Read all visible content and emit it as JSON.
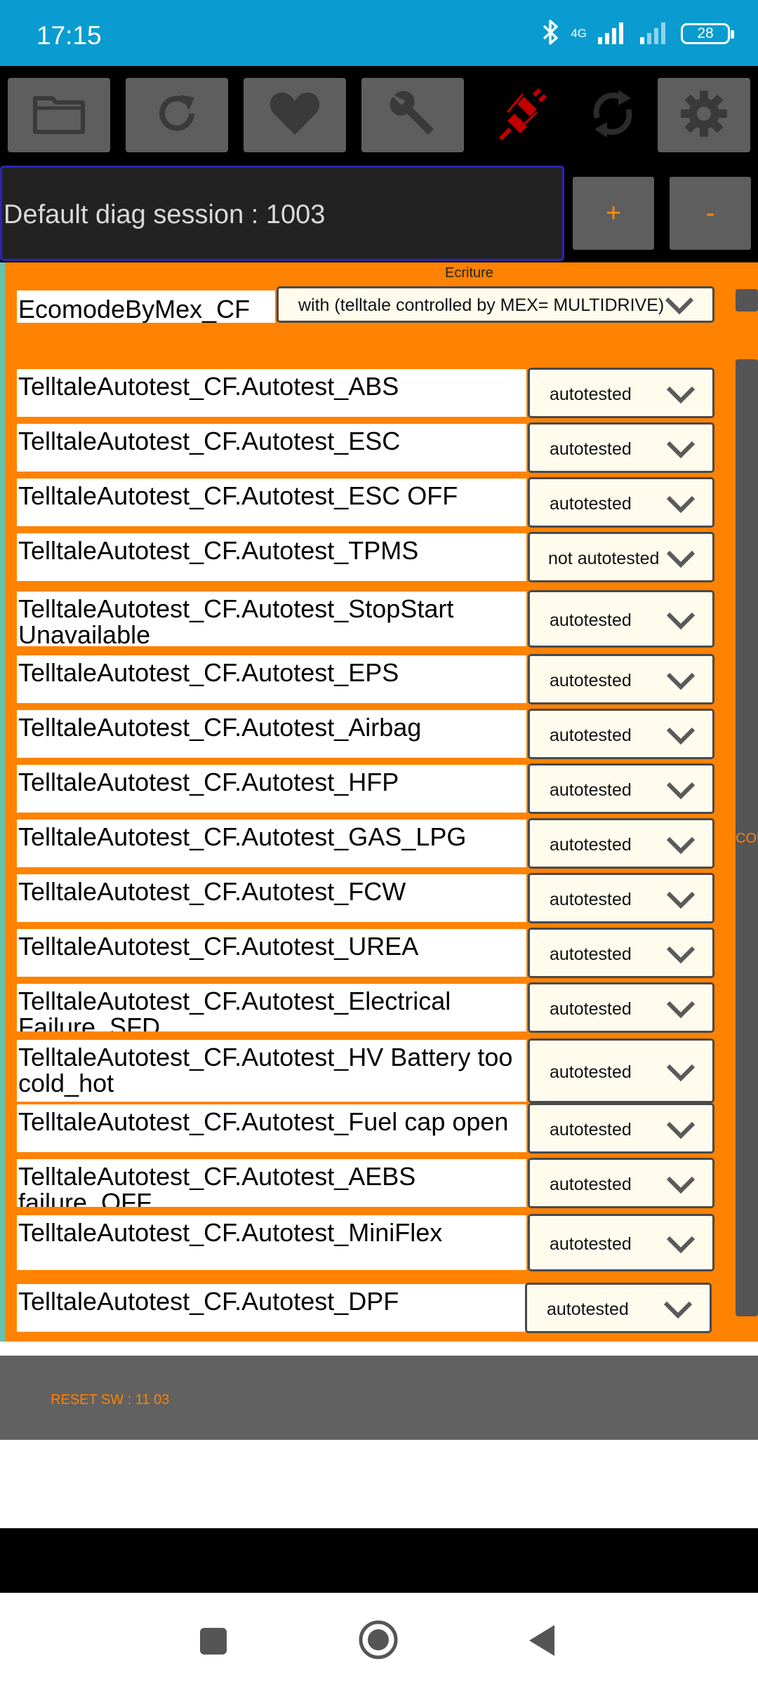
{
  "status_bar": {
    "time": "17:15",
    "network": "4G",
    "battery": "28",
    "icons": [
      "bluetooth-icon",
      "signal-icon",
      "signal-icon",
      "battery-icon"
    ]
  },
  "toolbar": {
    "icons": [
      "folder-icon",
      "refresh-icon",
      "heart-icon",
      "wrench-icon",
      "disconnected-plug-icon",
      "sync-icon",
      "gear-icon"
    ],
    "accent": "#ff8200",
    "plug_color": "#c00000"
  },
  "session": {
    "text": "Default diag session : 1003",
    "plus_label": "+",
    "minus_label": "-"
  },
  "panel": {
    "section_label": "Ecriture",
    "side_text": "CON",
    "ecomode": {
      "label": "EcomodeByMex_CF",
      "value": "with (telltale controlled by MEX= MULTIDRIVE)"
    },
    "rows": [
      {
        "label": "TelltaleAutotest_CF.Autotest_ABS",
        "value": "autotested"
      },
      {
        "label": "TelltaleAutotest_CF.Autotest_ESC",
        "value": "autotested"
      },
      {
        "label": "TelltaleAutotest_CF.Autotest_ESC OFF",
        "value": "autotested"
      },
      {
        "label": "TelltaleAutotest_CF.Autotest_TPMS",
        "value": "not autotested"
      },
      {
        "label": "TelltaleAutotest_CF.Autotest_StopStart Unavailable",
        "value": "autotested"
      },
      {
        "label": "TelltaleAutotest_CF.Autotest_EPS",
        "value": "autotested"
      },
      {
        "label": "TelltaleAutotest_CF.Autotest_Airbag",
        "value": "autotested"
      },
      {
        "label": "TelltaleAutotest_CF.Autotest_HFP",
        "value": "autotested"
      },
      {
        "label": "TelltaleAutotest_CF.Autotest_GAS_LPG",
        "value": "autotested"
      },
      {
        "label": "TelltaleAutotest_CF.Autotest_FCW",
        "value": "autotested"
      },
      {
        "label": "TelltaleAutotest_CF.Autotest_UREA",
        "value": "autotested"
      },
      {
        "label": "TelltaleAutotest_CF.Autotest_Electrical Failure_SFD",
        "value": "autotested"
      },
      {
        "label": "TelltaleAutotest_CF.Autotest_HV Battery too cold_hot",
        "value": "autotested"
      },
      {
        "label": "TelltaleAutotest_CF.Autotest_Fuel cap open",
        "value": "autotested"
      },
      {
        "label": "TelltaleAutotest_CF.Autotest_AEBS failure_OFF",
        "value": "autotested"
      },
      {
        "label": "TelltaleAutotest_CF.Autotest_MiniFlex",
        "value": "autotested"
      },
      {
        "label": "TelltaleAutotest_CF.Autotest_DPF",
        "value": "autotested"
      }
    ]
  },
  "footer": {
    "reset_text": "RESET SW : 11 03"
  },
  "nav": {
    "icons": [
      "recents-square-icon",
      "home-circle-icon",
      "back-triangle-icon"
    ]
  }
}
